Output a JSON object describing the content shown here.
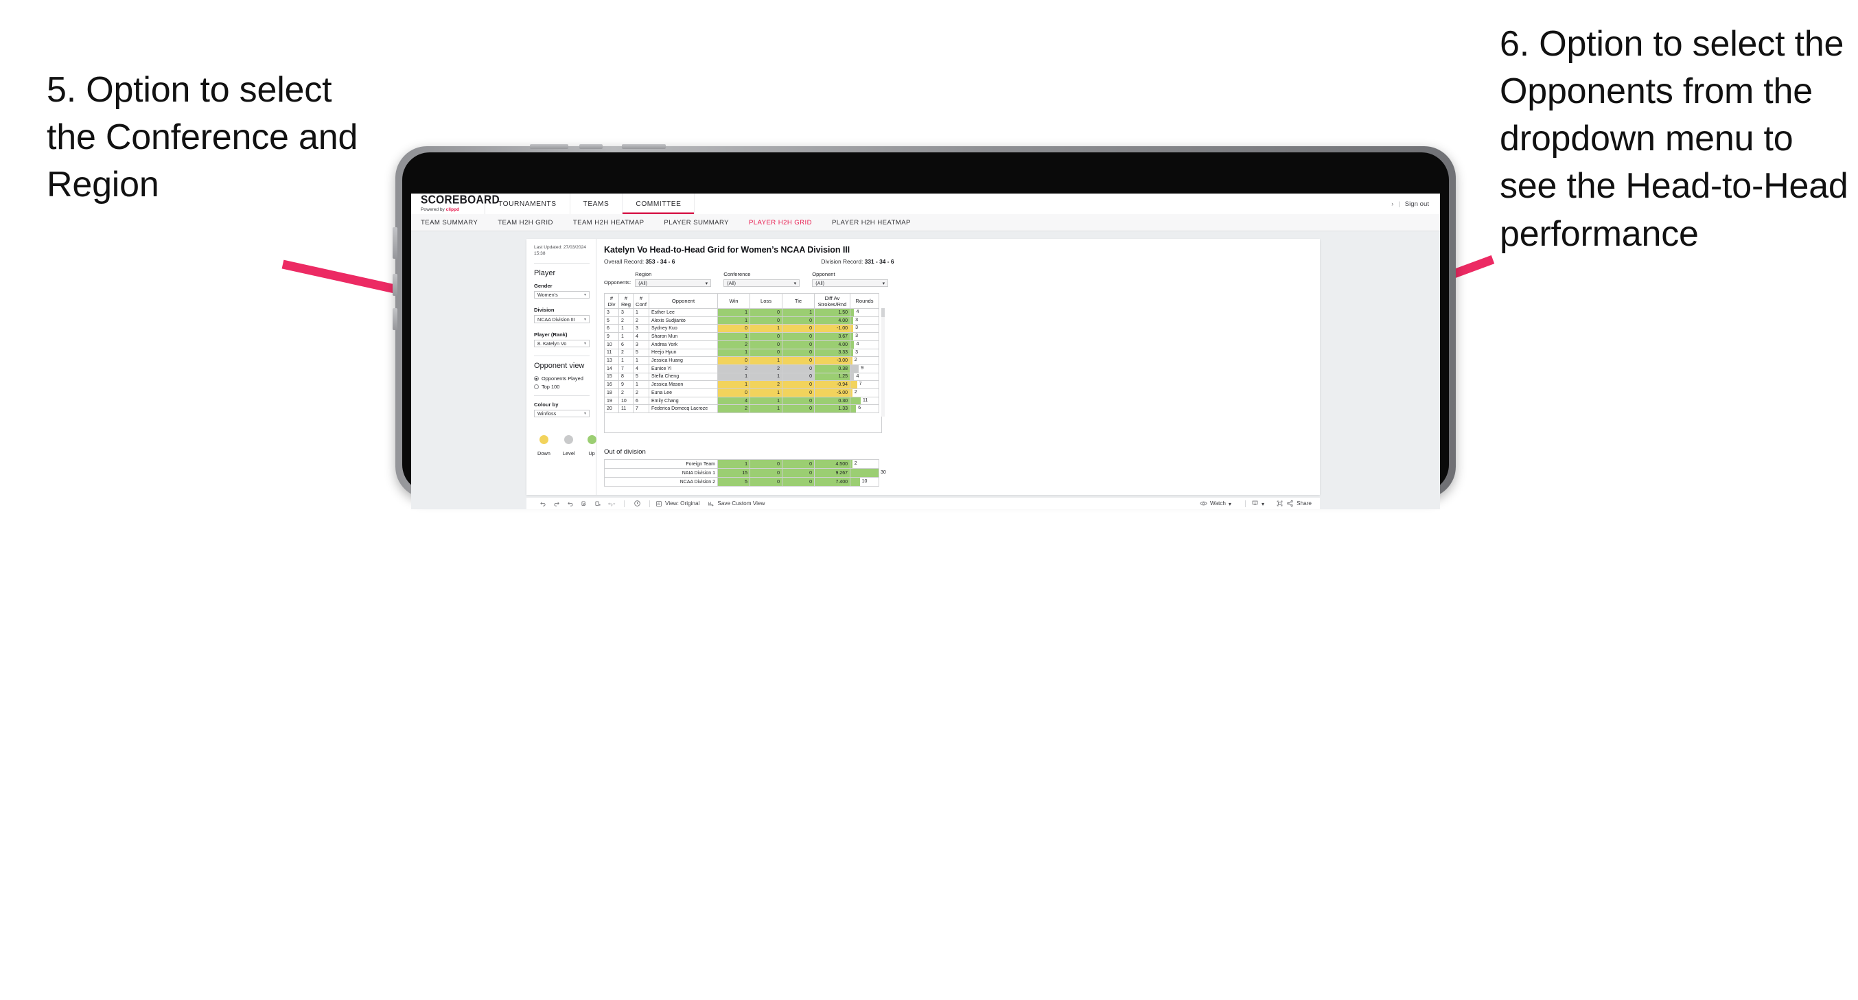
{
  "annotations": {
    "left": "5. Option to select the Conference and Region",
    "right": "6. Option to select the Opponents from the dropdown menu to see the Head-to-Head performance"
  },
  "colors": {
    "accent": "#e8174b",
    "arrow": "#ec2a63",
    "up_green": "#9bce72",
    "down_yellow": "#f2d35c",
    "level_grey": "#c9cacb"
  },
  "app": {
    "brand": {
      "title": "SCOREBOARD",
      "powered_prefix": "Powered by ",
      "powered_brand": "clippd"
    },
    "topnav": [
      {
        "label": "TOURNAMENTS",
        "active": false
      },
      {
        "label": "TEAMS",
        "active": false
      },
      {
        "label": "COMMITTEE",
        "active": true
      }
    ],
    "topbar_right": {
      "chevron": "›",
      "divider": "|",
      "sign_out": "Sign out"
    },
    "subnav": [
      {
        "label": "TEAM SUMMARY",
        "active": false
      },
      {
        "label": "TEAM H2H GRID",
        "active": false
      },
      {
        "label": "TEAM H2H HEATMAP",
        "active": false
      },
      {
        "label": "PLAYER SUMMARY",
        "active": false
      },
      {
        "label": "PLAYER H2H GRID",
        "active": true
      },
      {
        "label": "PLAYER H2H HEATMAP",
        "active": false
      }
    ]
  },
  "sidebar": {
    "last_updated": "Last Updated: 27/03/2024 15:38",
    "player_heading": "Player",
    "gender": {
      "label": "Gender",
      "value": "Women’s"
    },
    "division": {
      "label": "Division",
      "value": "NCAA Division III"
    },
    "player_rank": {
      "label": "Player (Rank)",
      "value": "8. Katelyn Vo"
    },
    "opponent_view": {
      "heading": "Opponent view",
      "options": [
        {
          "label": "Opponents Played",
          "selected": true
        },
        {
          "label": "Top 100",
          "selected": false
        }
      ]
    },
    "colour_by": {
      "label": "Colour by",
      "value": "Win/loss"
    },
    "legend": [
      {
        "caption": "Down",
        "color": "#f2d35c"
      },
      {
        "caption": "Level",
        "color": "#c9cacb"
      },
      {
        "caption": "Up",
        "color": "#9bce72"
      }
    ]
  },
  "main": {
    "title": "Katelyn Vo Head-to-Head Grid for Women’s NCAA Division III",
    "overall_record_label": "Overall Record: ",
    "overall_record_value": "353 - 34 - 6",
    "division_record_label": "Division Record: ",
    "division_record_value": "331 - 34 - 6",
    "filters_label": "Opponents:",
    "filters": [
      {
        "label": "Region",
        "value": "(All)"
      },
      {
        "label": "Conference",
        "value": "(All)"
      },
      {
        "label": "Opponent",
        "value": "(All)"
      }
    ]
  },
  "chart_data": {
    "type": "table",
    "title": "Katelyn Vo Head-to-Head Grid for Women’s NCAA Division III",
    "columns": [
      "# Div",
      "# Reg",
      "# Conf",
      "Opponent",
      "Win",
      "Loss",
      "Tie",
      "Diff Av Strokes/Rnd",
      "Rounds"
    ],
    "column_headers_two_line": [
      {
        "l1": "#",
        "l2": "Div"
      },
      {
        "l1": "#",
        "l2": "Reg"
      },
      {
        "l1": "#",
        "l2": "Conf"
      },
      {
        "l1": "Opponent",
        "l2": ""
      },
      {
        "l1": "Win",
        "l2": ""
      },
      {
        "l1": "Loss",
        "l2": ""
      },
      {
        "l1": "Tie",
        "l2": ""
      },
      {
        "l1": "Diff Av",
        "l2": "Strokes/Rnd"
      },
      {
        "l1": "Rounds",
        "l2": ""
      }
    ],
    "rounds_max": 30,
    "rows": [
      {
        "div": "3",
        "reg": "3",
        "conf": "1",
        "opponent": "Esther Lee",
        "win": "1",
        "loss": "0",
        "tie": "1",
        "diff": "1.50",
        "rounds": "4",
        "rounds_val": 4,
        "color": "up"
      },
      {
        "div": "5",
        "reg": "2",
        "conf": "2",
        "opponent": "Alexis Sudjianto",
        "win": "1",
        "loss": "0",
        "tie": "0",
        "diff": "4.00",
        "rounds": "3",
        "rounds_val": 3,
        "color": "up"
      },
      {
        "div": "6",
        "reg": "1",
        "conf": "3",
        "opponent": "Sydney Kuo",
        "win": "0",
        "loss": "1",
        "tie": "0",
        "diff": "-1.00",
        "rounds": "3",
        "rounds_val": 3,
        "color": "down"
      },
      {
        "div": "9",
        "reg": "1",
        "conf": "4",
        "opponent": "Sharon Mun",
        "win": "1",
        "loss": "0",
        "tie": "0",
        "diff": "3.67",
        "rounds": "3",
        "rounds_val": 3,
        "color": "up"
      },
      {
        "div": "10",
        "reg": "6",
        "conf": "3",
        "opponent": "Andrea York",
        "win": "2",
        "loss": "0",
        "tie": "0",
        "diff": "4.00",
        "rounds": "4",
        "rounds_val": 4,
        "color": "up"
      },
      {
        "div": "11",
        "reg": "2",
        "conf": "5",
        "opponent": "Heejo Hyun",
        "win": "1",
        "loss": "0",
        "tie": "0",
        "diff": "3.33",
        "rounds": "3",
        "rounds_val": 3,
        "color": "up"
      },
      {
        "div": "13",
        "reg": "1",
        "conf": "1",
        "opponent": "Jessica Huang",
        "win": "0",
        "loss": "1",
        "tie": "0",
        "diff": "-3.00",
        "rounds": "2",
        "rounds_val": 2,
        "color": "down"
      },
      {
        "div": "14",
        "reg": "7",
        "conf": "4",
        "opponent": "Eunice Yi",
        "win": "2",
        "loss": "2",
        "tie": "0",
        "diff": "0.38",
        "rounds": "9",
        "rounds_val": 9,
        "color": "level",
        "diff_color": "up"
      },
      {
        "div": "15",
        "reg": "8",
        "conf": "5",
        "opponent": "Stella Cheng",
        "win": "1",
        "loss": "1",
        "tie": "0",
        "diff": "1.25",
        "rounds": "4",
        "rounds_val": 4,
        "color": "level",
        "diff_color": "up"
      },
      {
        "div": "16",
        "reg": "9",
        "conf": "1",
        "opponent": "Jessica Mason",
        "win": "1",
        "loss": "2",
        "tie": "0",
        "diff": "-0.94",
        "rounds": "7",
        "rounds_val": 7,
        "color": "down"
      },
      {
        "div": "18",
        "reg": "2",
        "conf": "2",
        "opponent": "Euna Lee",
        "win": "0",
        "loss": "1",
        "tie": "0",
        "diff": "-5.00",
        "rounds": "2",
        "rounds_val": 2,
        "color": "down"
      },
      {
        "div": "19",
        "reg": "10",
        "conf": "6",
        "opponent": "Emily Chang",
        "win": "4",
        "loss": "1",
        "tie": "0",
        "diff": "0.30",
        "rounds": "11",
        "rounds_val": 11,
        "color": "up"
      },
      {
        "div": "20",
        "reg": "11",
        "conf": "7",
        "opponent": "Federica Domecq Lacroze",
        "win": "2",
        "loss": "1",
        "tie": "0",
        "diff": "1.33",
        "rounds": "6",
        "rounds_val": 6,
        "color": "up"
      }
    ],
    "out_of_division": {
      "title": "Out of division",
      "rounds_max": 30,
      "rows": [
        {
          "name": "Foreign Team",
          "win": "1",
          "loss": "0",
          "tie": "0",
          "diff": "4.500",
          "rounds": "2",
          "rounds_val": 2,
          "color": "up"
        },
        {
          "name": "NAIA Division 1",
          "win": "15",
          "loss": "0",
          "tie": "0",
          "diff": "9.267",
          "rounds": "30",
          "rounds_val": 30,
          "color": "up"
        },
        {
          "name": "NCAA Division 2",
          "win": "5",
          "loss": "0",
          "tie": "0",
          "diff": "7.400",
          "rounds": "10",
          "rounds_val": 10,
          "color": "up"
        }
      ]
    }
  },
  "toolbar": {
    "view_label": "View: Original",
    "save_custom_view": "Save Custom View",
    "watch": "Watch",
    "share": "Share"
  }
}
